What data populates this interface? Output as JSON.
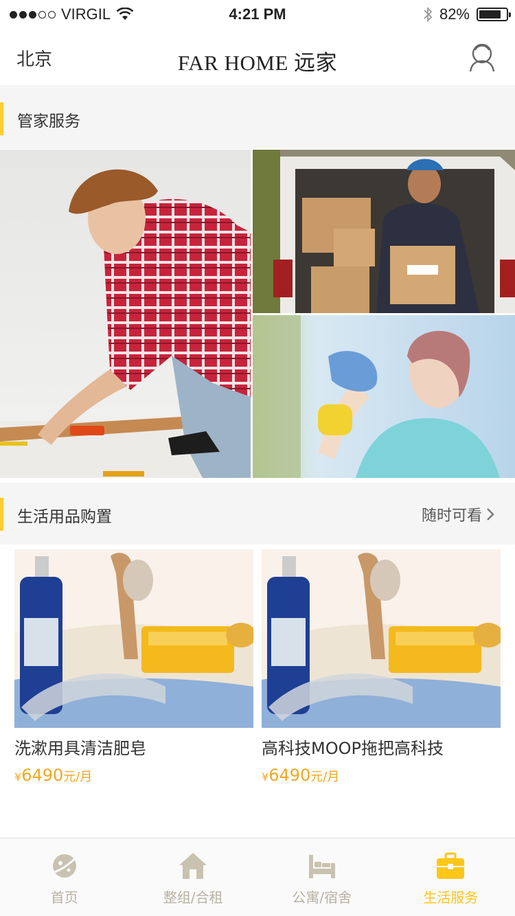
{
  "status_bar": {
    "carrier": "VIRGIL",
    "time": "4:21 PM",
    "battery": "82%",
    "battery_level": 0.82,
    "signal_bars": 3
  },
  "nav": {
    "city": "北京",
    "brand": "FAR HOME 远家",
    "user_icon": "user-icon"
  },
  "butler_section": {
    "title": "管家服务"
  },
  "life_section": {
    "title": "生活用品购置",
    "more_label": "随时可看"
  },
  "products": [
    {
      "name": "洗漱用具清洁肥皂",
      "currency": "¥",
      "price": "6490",
      "unit": "元/月"
    },
    {
      "name": "高科技MOOP拖把高科技",
      "currency": "¥",
      "price": "6490",
      "unit": "元/月"
    }
  ],
  "tabs": [
    {
      "label": "首页",
      "icon": "planet-icon",
      "active": false
    },
    {
      "label": "整组/合租",
      "icon": "house-icon",
      "active": false
    },
    {
      "label": "公寓/宿舍",
      "icon": "bed-icon",
      "active": false
    },
    {
      "label": "生活服务",
      "icon": "briefcase-icon",
      "active": true
    }
  ],
  "colors": {
    "accent": "#ffcc33",
    "price": "#f0a81e",
    "tab_inactive": "#c9c2b0",
    "tab_active": "#ffc61a"
  }
}
